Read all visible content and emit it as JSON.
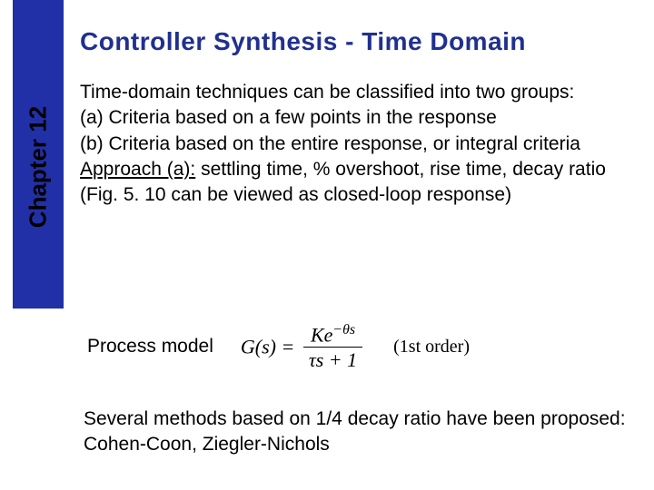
{
  "sidebar": {
    "label": "Chapter 12"
  },
  "title": "Controller Synthesis - Time Domain",
  "body": {
    "intro": "Time-domain techniques can be classified into two groups:",
    "item_a": "(a) Criteria based on a few points in the response",
    "item_b": "(b) Criteria based on the entire response, or integral criteria",
    "approach_label": "Approach (a):",
    "approach_text": " settling time, % overshoot, rise time, decay ratio (Fig. 5. 10 can be viewed as closed-loop response)"
  },
  "process": {
    "label": "Process model",
    "formula": {
      "lhs": "G(s) =",
      "numerator_K": "K",
      "numerator_e": "e",
      "numerator_exp": "−θs",
      "denominator": "τs + 1"
    },
    "note": "(1st order)"
  },
  "footer": "Several methods based on 1/4 decay ratio have been proposed: Cohen-Coon, Ziegler-Nichols"
}
